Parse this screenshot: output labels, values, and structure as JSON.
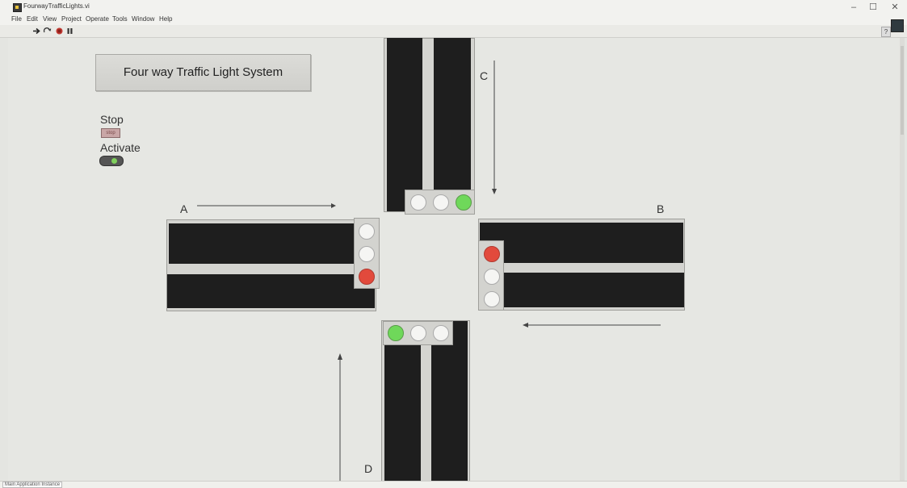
{
  "window": {
    "title": "FourwayTrafficLights.vi",
    "minimize": "–",
    "maximize": "☐",
    "close": "✕"
  },
  "menu": [
    "File",
    "Edit",
    "View",
    "Project",
    "Operate",
    "Tools",
    "Window",
    "Help"
  ],
  "toolbar": {
    "run_icon": "run-arrow-icon",
    "run_continuous_icon": "run-continuously-icon",
    "abort_icon": "abort-icon",
    "pause_icon": "pause-icon",
    "help": "?"
  },
  "panel": {
    "title_button": "Four way Traffic Light System",
    "stop_label": "Stop",
    "stop_button": "stop",
    "activate_label": "Activate"
  },
  "directions": {
    "a": "A",
    "b": "B",
    "c": "C",
    "d": "D"
  },
  "lights": {
    "north": [
      "off",
      "off",
      "green"
    ],
    "west": [
      "off",
      "off",
      "red"
    ],
    "east": [
      "red",
      "off",
      "off"
    ],
    "south": [
      "green",
      "off",
      "off"
    ]
  },
  "status": {
    "instance": "Main Application Instance"
  },
  "colors": {
    "green": "#6fd85a",
    "red": "#e24a3c",
    "off": "#f5f5f3",
    "road": "#1e1e1e"
  }
}
